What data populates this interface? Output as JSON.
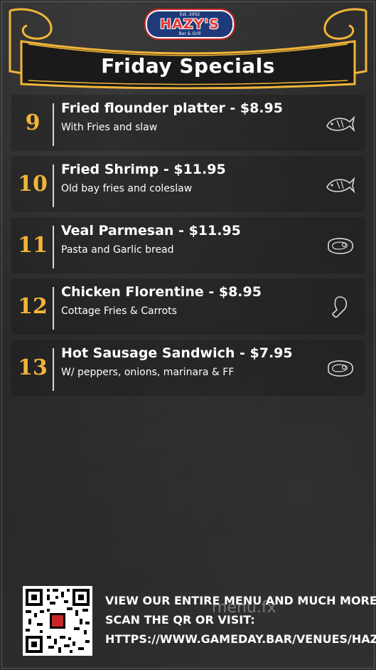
{
  "logo": {
    "top_text": "Est. 2002",
    "name": "HAZY'S",
    "bottom_text": "Bar & Grill"
  },
  "title": "Friday Specials",
  "items": [
    {
      "number": "9",
      "name": "Fried flounder platter  - $8.95",
      "description": "With Fries and slaw",
      "icon": "fish-icon"
    },
    {
      "number": "10",
      "name": "Fried Shrimp - $11.95",
      "description": "Old bay fries and coleslaw",
      "icon": "fish-icon"
    },
    {
      "number": "11",
      "name": "Veal Parmesan - $11.95",
      "description": "Pasta and Garlic bread",
      "icon": "steak-icon"
    },
    {
      "number": "12",
      "name": "Chicken Florentine - $8.95",
      "description": "Cottage Fries & Carrots",
      "icon": "chicken-leg-icon"
    },
    {
      "number": "13",
      "name": "Hot Sausage Sandwich - $7.95",
      "description": "W/ peppers, onions, marinara & FF",
      "icon": "steak-icon"
    }
  ],
  "footer": {
    "line1": "VIEW OUR ENTIRE MENU AND MUCH MORE",
    "line2": "SCAN THE QR OR VISIT:",
    "line3": "HTTPS://WWW.GAMEDAY.BAR/VENUES/HAZY",
    "watermark": "menu.fx"
  },
  "colors": {
    "accent": "#f2b538",
    "text": "#ffffff",
    "board": "#2b2b2b"
  }
}
